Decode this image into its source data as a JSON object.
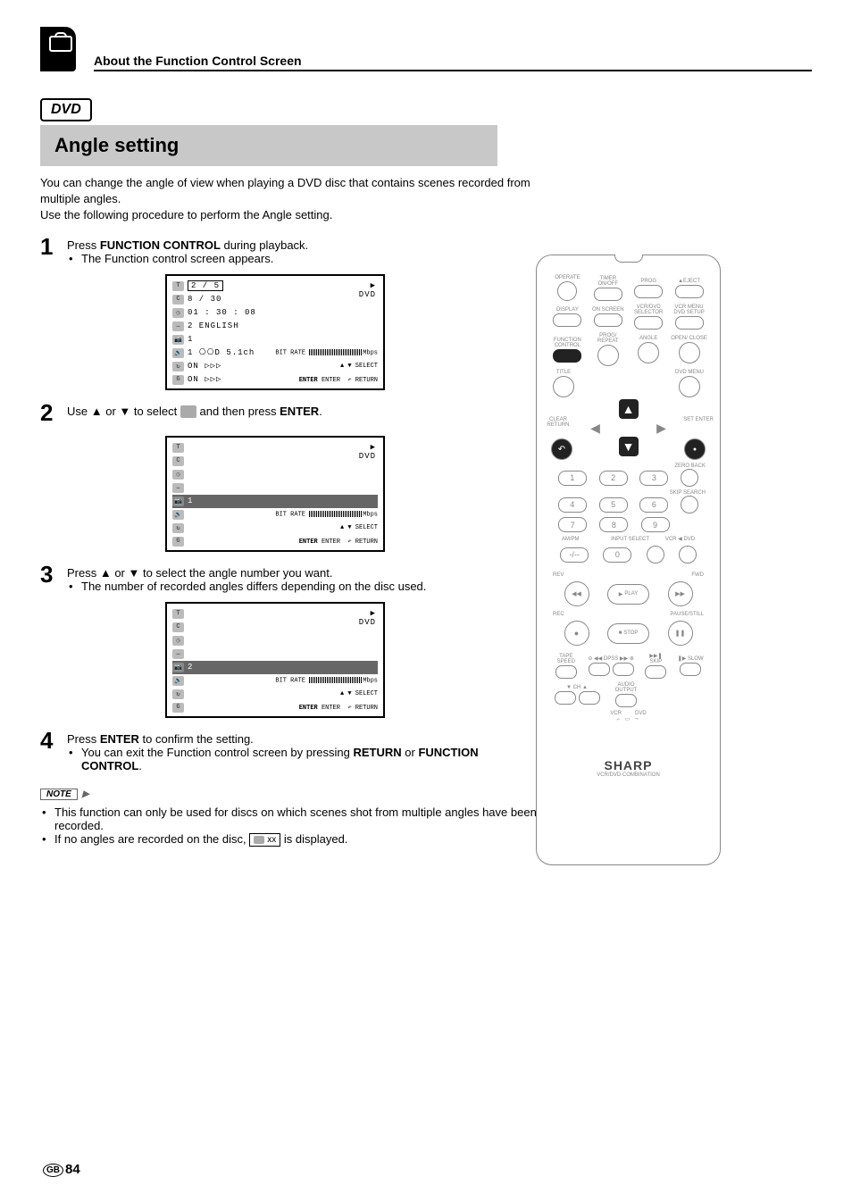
{
  "header": {
    "section_title": "About the Function Control Screen",
    "dvd_tag": "DVD",
    "heading": "Angle setting"
  },
  "intro": {
    "p1": "You can change the angle of view when playing a DVD disc that contains scenes recorded from multiple angles.",
    "p2": "Use the following procedure to perform the Angle setting."
  },
  "steps": {
    "s1": {
      "num": "1",
      "text_a": "Press ",
      "text_b": "FUNCTION CONTROL",
      "text_c": " during playback.",
      "bullet": "The Function control screen appears."
    },
    "s2": {
      "num": "2",
      "text_a": "Use ▲ or ▼ to select ",
      "text_b": " and then press ",
      "text_c": "ENTER",
      "text_d": "."
    },
    "s3": {
      "num": "3",
      "text_a": "Press ▲ or ▼ to select the angle number you want.",
      "bullet": "The number of recorded angles differs depending on the disc used."
    },
    "s4": {
      "num": "4",
      "text_a": "Press ",
      "text_b": "ENTER",
      "text_c": " to confirm the setting.",
      "bullet_a": "You can exit the Function control screen by pressing ",
      "bullet_b": "RETURN",
      "bullet_c": " or ",
      "bullet_d": "FUNCTION CONTROL",
      "bullet_e": "."
    }
  },
  "osd1": {
    "dvd": "DVD",
    "title": "2 / 5",
    "chapter": "8 / 30",
    "time": "01 : 30 : 08",
    "subtitle": "2  ENGLISH",
    "angle": "1",
    "audio": "1  ⎔⎔D   5.1ch",
    "repeat": "ON   ▷▷▷",
    "gigo": "ON   ▷▷▷",
    "bitrate_label": "BIT RATE",
    "bitrate_scale": "0            5           10",
    "bitrate_unit": "Mbps",
    "select_hint": "▲ ▼ SELECT",
    "enter_hint": "ENTER",
    "enter_word": "ENTER",
    "return_word": "RETURN"
  },
  "osd2": {
    "dvd": "DVD",
    "angle_val": "1"
  },
  "osd3": {
    "dvd": "DVD",
    "angle_val": "2"
  },
  "note": {
    "tag": "NOTE",
    "li1": "This function can only be used for discs on which scenes shot from multiple angles have been recorded.",
    "li2_a": "If no angles are recorded on the disc, ",
    "li2_b": "xx",
    "li2_c": " is displayed."
  },
  "remote": {
    "row1": {
      "operate": "OPERATE",
      "timer": "TIMER\nON/OFF",
      "prog": "PROG",
      "eject": "▲EJECT"
    },
    "row2": {
      "display": "DISPLAY",
      "onscreen": "ON\nSCREEN",
      "selector": "VCR/DVD\nSELECTOR",
      "dvdmenu": "VCR MENU\nDVD SETUP"
    },
    "row3": {
      "function": "FUNCTION\nCONTROL",
      "progrep": "PROG/\nREPEAT",
      "angle": "ANGLE",
      "openclose": "OPEN/\nCLOSE"
    },
    "row4": {
      "title": "TITLE",
      "dvdmenu2": "DVD MENU"
    },
    "cross": {
      "clear": "CLEAR\nRETURN",
      "setenter": "SET\nENTER"
    },
    "labels": {
      "zeroback": "ZERO BACK",
      "skipsearch": "SKIP SEARCH",
      "ampm": "AM/PM",
      "input": "INPUT SELECT",
      "vcrdvd": "VCR ◀ DVD",
      "rev": "REV",
      "fwd": "FWD",
      "play": "PLAY",
      "rec": "REC",
      "pause": "PAUSE/STILL",
      "stop": "STOP",
      "tape": "TAPE\nSPEED",
      "dpss": "DPSS",
      "skip": "SKIP",
      "slow": "SLOW",
      "ch": "CH",
      "audio": "AUDIO\nOUTPUT",
      "vcr": "VCR",
      "dvd": "DVD"
    },
    "nums": [
      "1",
      "2",
      "3",
      "4",
      "5",
      "6",
      "7",
      "8",
      "9",
      "-/--",
      "0"
    ],
    "brand": "SHARP",
    "brand_sub": "VCR/DVD COMBINATION"
  },
  "page": {
    "gb": "GB",
    "num": "84"
  }
}
